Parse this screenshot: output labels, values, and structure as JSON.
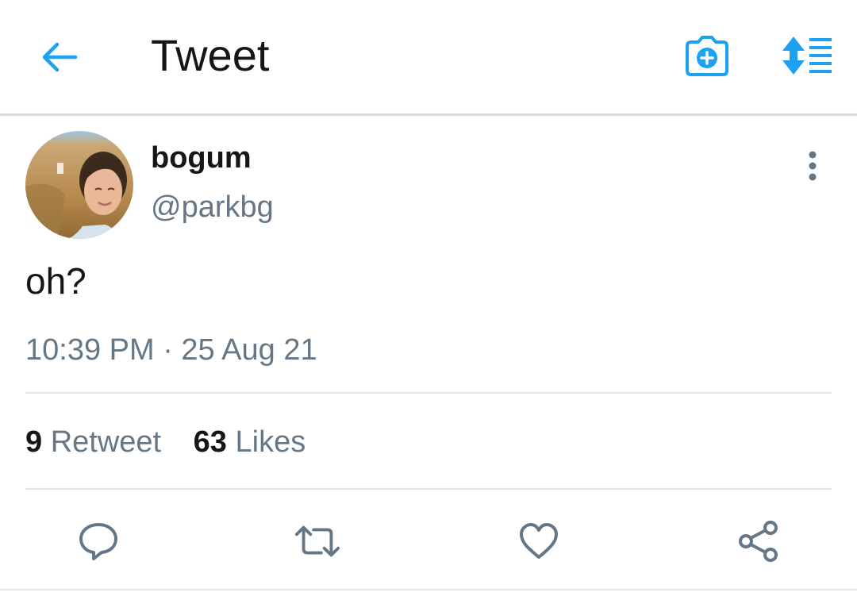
{
  "header": {
    "title": "Tweet",
    "accent_color": "#1da1f2"
  },
  "tweet": {
    "author": {
      "display_name": "bogum",
      "handle": "@parkbg"
    },
    "text": "oh?",
    "timestamp": "10:39 PM · 25 Aug 21",
    "stats": {
      "retweets_count": "9",
      "retweets_label": "Retweet",
      "likes_count": "63",
      "likes_label": "Likes"
    }
  },
  "icons": {
    "back": "arrow-left-icon",
    "camera": "camera-plus-icon",
    "sort": "sort-list-icon",
    "more": "more-vertical-icon",
    "reply": "reply-icon",
    "retweet": "retweet-icon",
    "like": "heart-icon",
    "share": "share-icon"
  },
  "colors": {
    "primary_text": "#14171a",
    "secondary_text": "#657786",
    "divider": "#e1e6ea"
  }
}
